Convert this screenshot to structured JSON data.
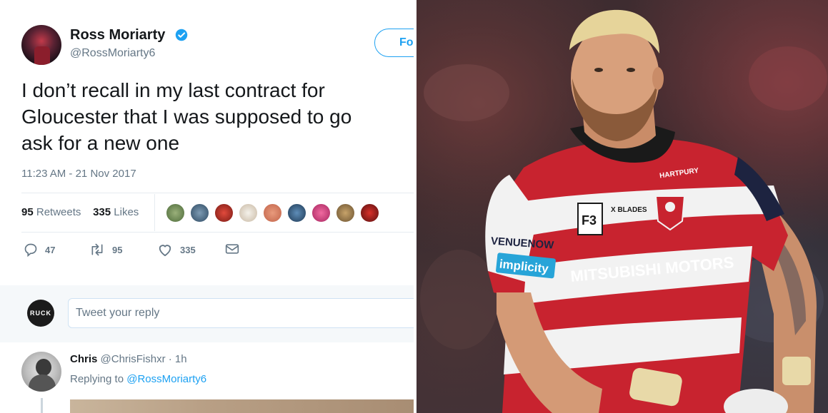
{
  "tweet": {
    "author_name": "Ross Moriarty",
    "author_handle": "@RossMoriarty6",
    "follow_label": "Fo",
    "text_lines": [
      "I don’t recall in my last contract for",
      "Gloucester that I was supposed to go",
      "ask for a new one"
    ],
    "timestamp": "11:23 AM - 21 Nov 2017",
    "retweets_count": "95",
    "retweets_label": "Retweets",
    "likes_count": "335",
    "likes_label": "Likes",
    "actions": {
      "reply_count": "47",
      "retweet_count": "95",
      "like_count": "335"
    },
    "colors": {
      "accent": "#1da1f2",
      "text": "#14171a",
      "muted": "#657786"
    }
  },
  "reply_box": {
    "avatar_text": "RUCK",
    "placeholder": "Tweet your reply"
  },
  "reply": {
    "name": "Chris",
    "handle": "@ChrisFishxr",
    "time": "· 1h",
    "replying_prefix": "Replying to",
    "replying_handle": "@RossMoriarty6"
  },
  "photo": {
    "shirt_sponsor": "MITSUBISHI MOTORS",
    "sleeve_sponsor": "implicity",
    "sleeve_text": "VENUENOW",
    "collar_text": "HARTPURY",
    "badge_text": "X BLADES",
    "number_text": "F3",
    "colors": {
      "red": "#c8232f",
      "white": "#f2f2f2",
      "navy": "#1d2340"
    }
  }
}
